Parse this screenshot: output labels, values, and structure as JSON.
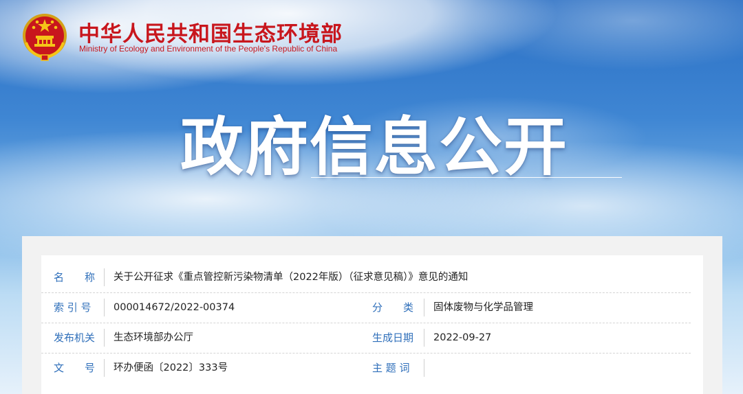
{
  "header": {
    "org_name_cn": "中华人民共和国生态环境部",
    "org_name_en": "Ministry of Ecology and Environment of the People's Republic of China",
    "emblem_icon": "national-emblem-icon"
  },
  "hero": {
    "title": "政府信息公开"
  },
  "info": {
    "name_label": "名　　称",
    "name_value": "关于公开征求《重点管控新污染物清单（2022年版）（征求意见稿）》意见的通知",
    "index_label": "索 引 号",
    "index_value": "000014672/2022-00374",
    "category_label": "分　　类",
    "category_value": "固体废物与化学品管理",
    "issuer_label": "发布机关",
    "issuer_value": "生态环境部办公厅",
    "date_label": "生成日期",
    "date_value": "2022-09-27",
    "doc_no_label": "文　　号",
    "doc_no_value": "环办便函〔2022〕333号",
    "keywords_label": "主 题 词",
    "keywords_value": ""
  },
  "colors": {
    "brand_red": "#c8161d",
    "label_blue": "#2f6fba",
    "sky_blue": "#3f86d3"
  }
}
